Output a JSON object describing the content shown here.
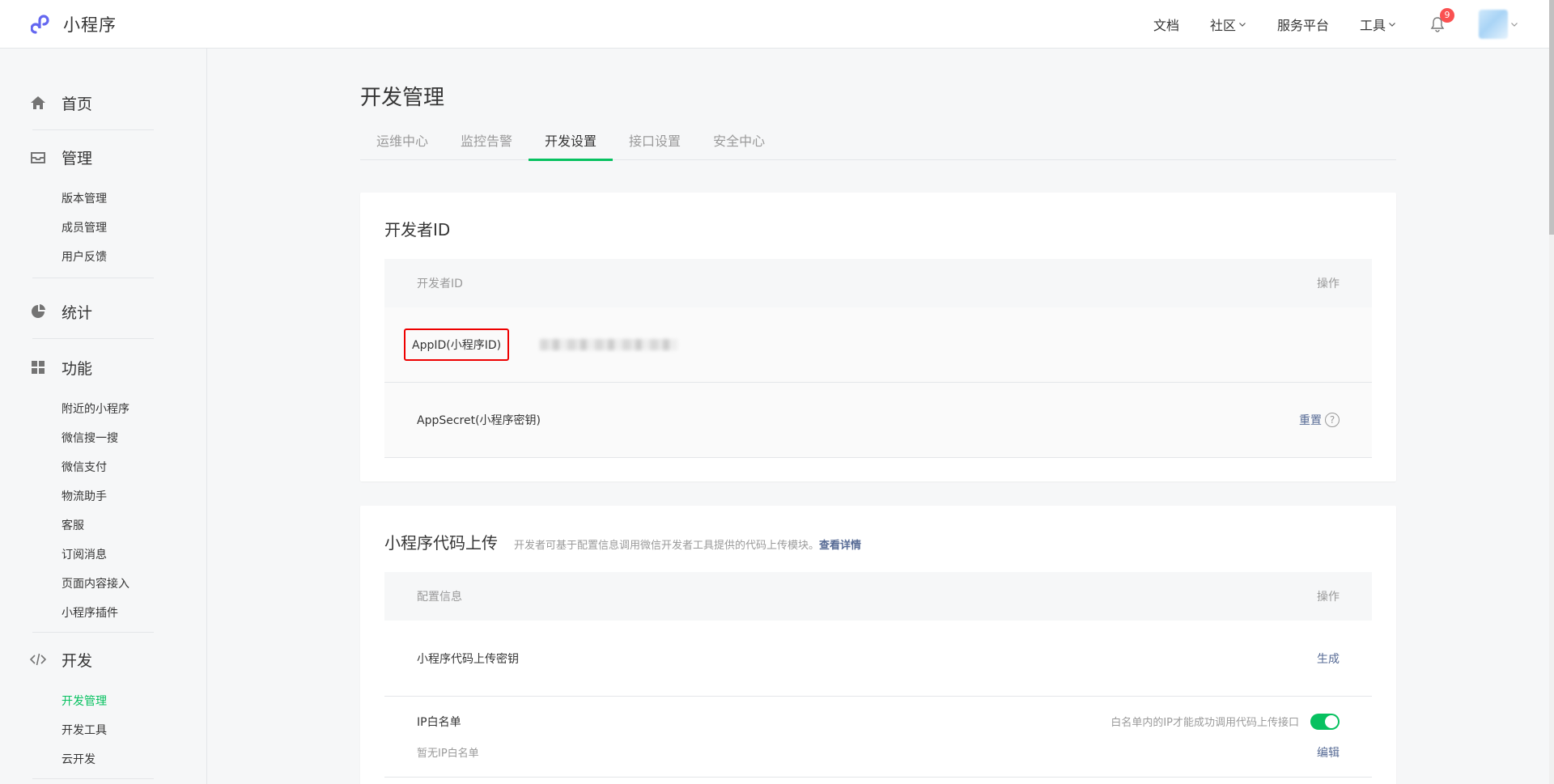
{
  "brand": {
    "name": "小程序",
    "accent": "#07c160",
    "logo_color": "#6467f0"
  },
  "topnav": {
    "docs": "文档",
    "community": "社区",
    "service": "服务平台",
    "tools": "工具",
    "notifications": "9"
  },
  "sidebar": {
    "home": "首页",
    "manage": {
      "title": "管理",
      "items": [
        "版本管理",
        "成员管理",
        "用户反馈"
      ]
    },
    "stats": "统计",
    "features": {
      "title": "功能",
      "items": [
        "附近的小程序",
        "微信搜一搜",
        "微信支付",
        "物流助手",
        "客服",
        "订阅消息",
        "页面内容接入",
        "小程序插件"
      ]
    },
    "dev": {
      "title": "开发",
      "items": [
        "开发管理",
        "开发工具",
        "云开发"
      ],
      "active_index": 0
    }
  },
  "page": {
    "title": "开发管理",
    "tabs": [
      "运维中心",
      "监控告警",
      "开发设置",
      "接口设置",
      "安全中心"
    ],
    "active_tab": 2
  },
  "developer_card": {
    "title": "开发者ID",
    "col_left": "开发者ID",
    "col_right": "操作",
    "appid_label": "AppID(小程序ID)",
    "appsecret_label": "AppSecret(小程序密钥)",
    "reset": "重置",
    "help": "?"
  },
  "upload_card": {
    "title": "小程序代码上传",
    "desc": "开发者可基于配置信息调用微信开发者工具提供的代码上传模块。",
    "desc_link": "查看详情",
    "col_left": "配置信息",
    "col_right": "操作",
    "key_label": "小程序代码上传密钥",
    "generate": "生成",
    "whitelist_label": "IP白名单",
    "whitelist_empty": "暂无IP白名单",
    "whitelist_hint": "白名单内的IP才能成功调用代码上传接口",
    "whitelist_enabled": true,
    "edit": "编辑"
  }
}
